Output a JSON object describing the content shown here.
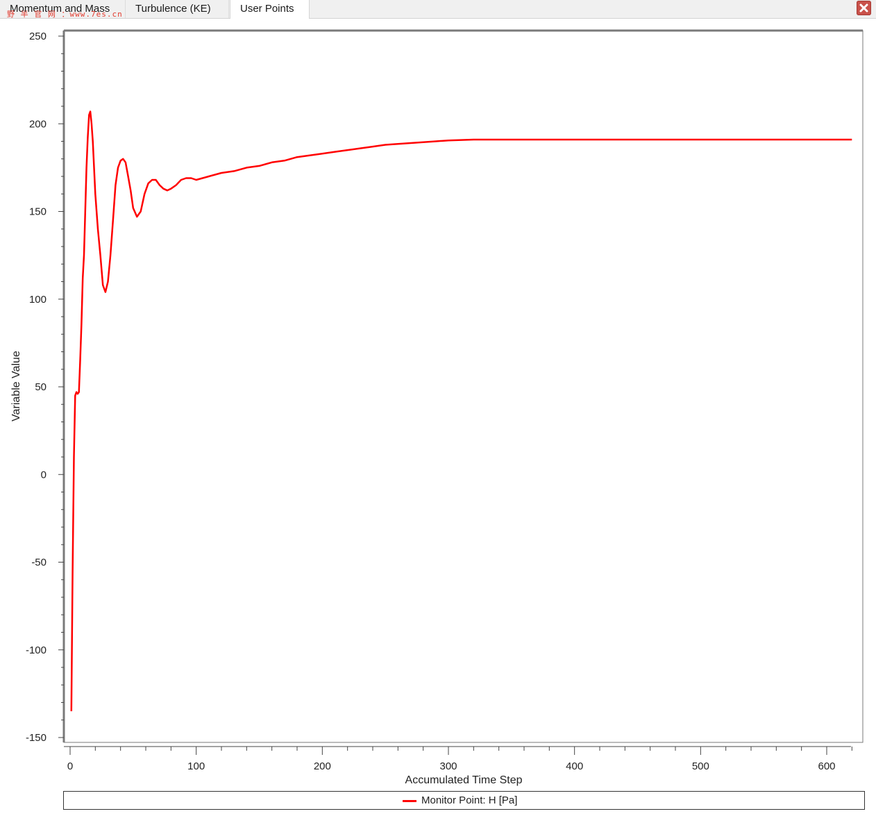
{
  "tabs": [
    {
      "label": "Momentum and Mass",
      "active": false
    },
    {
      "label": "Turbulence (KE)",
      "active": false
    },
    {
      "label": "User Points",
      "active": true
    }
  ],
  "watermark": "野 半 官 网 ：www.7es.cn",
  "close_icon": "close-icon",
  "colors": {
    "series": "#ff0000",
    "grid": "#c8c8c8",
    "close_button": "#c9514a"
  },
  "chart_data": {
    "type": "line",
    "xlabel": "Accumulated Time Step",
    "ylabel": "Variable Value",
    "xlim": [
      -4,
      623
    ],
    "ylim": [
      -150,
      250
    ],
    "x_ticks": [
      0,
      100,
      200,
      300,
      400,
      500,
      600
    ],
    "y_ticks": [
      250,
      200,
      150,
      100,
      50,
      0,
      -50,
      -100,
      -150
    ],
    "grid": true,
    "legend_position": "bottom",
    "series": [
      {
        "name": "Monitor Point: H [Pa]",
        "color": "#ff0000",
        "x": [
          1,
          2,
          3,
          4,
          5,
          6,
          7,
          8,
          9,
          10,
          11,
          12,
          13,
          14,
          15,
          16,
          17,
          18,
          19,
          20,
          22,
          24,
          26,
          28,
          30,
          32,
          34,
          36,
          38,
          40,
          42,
          44,
          46,
          48,
          50,
          53,
          56,
          59,
          62,
          65,
          68,
          71,
          74,
          77,
          80,
          84,
          88,
          92,
          96,
          100,
          105,
          110,
          120,
          130,
          140,
          150,
          160,
          170,
          180,
          190,
          200,
          210,
          220,
          230,
          240,
          250,
          260,
          270,
          280,
          290,
          300,
          320,
          350,
          400,
          450,
          500,
          550,
          600,
          620
        ],
        "y": [
          -135,
          -55,
          10,
          45,
          47,
          46,
          47,
          65,
          85,
          112,
          125,
          150,
          175,
          192,
          205,
          207,
          200,
          190,
          175,
          160,
          140,
          125,
          108,
          104,
          110,
          125,
          145,
          165,
          175,
          179,
          180,
          178,
          170,
          162,
          152,
          147,
          150,
          160,
          166,
          168,
          168,
          165,
          163,
          162,
          163,
          165,
          168,
          169,
          169,
          168,
          169,
          170,
          172,
          173,
          175,
          176,
          178,
          179,
          181,
          182,
          183,
          184,
          185,
          186,
          187,
          188,
          188.5,
          189,
          189.5,
          190,
          190.5,
          191,
          191,
          191,
          191,
          191,
          191,
          191,
          191
        ]
      }
    ]
  }
}
